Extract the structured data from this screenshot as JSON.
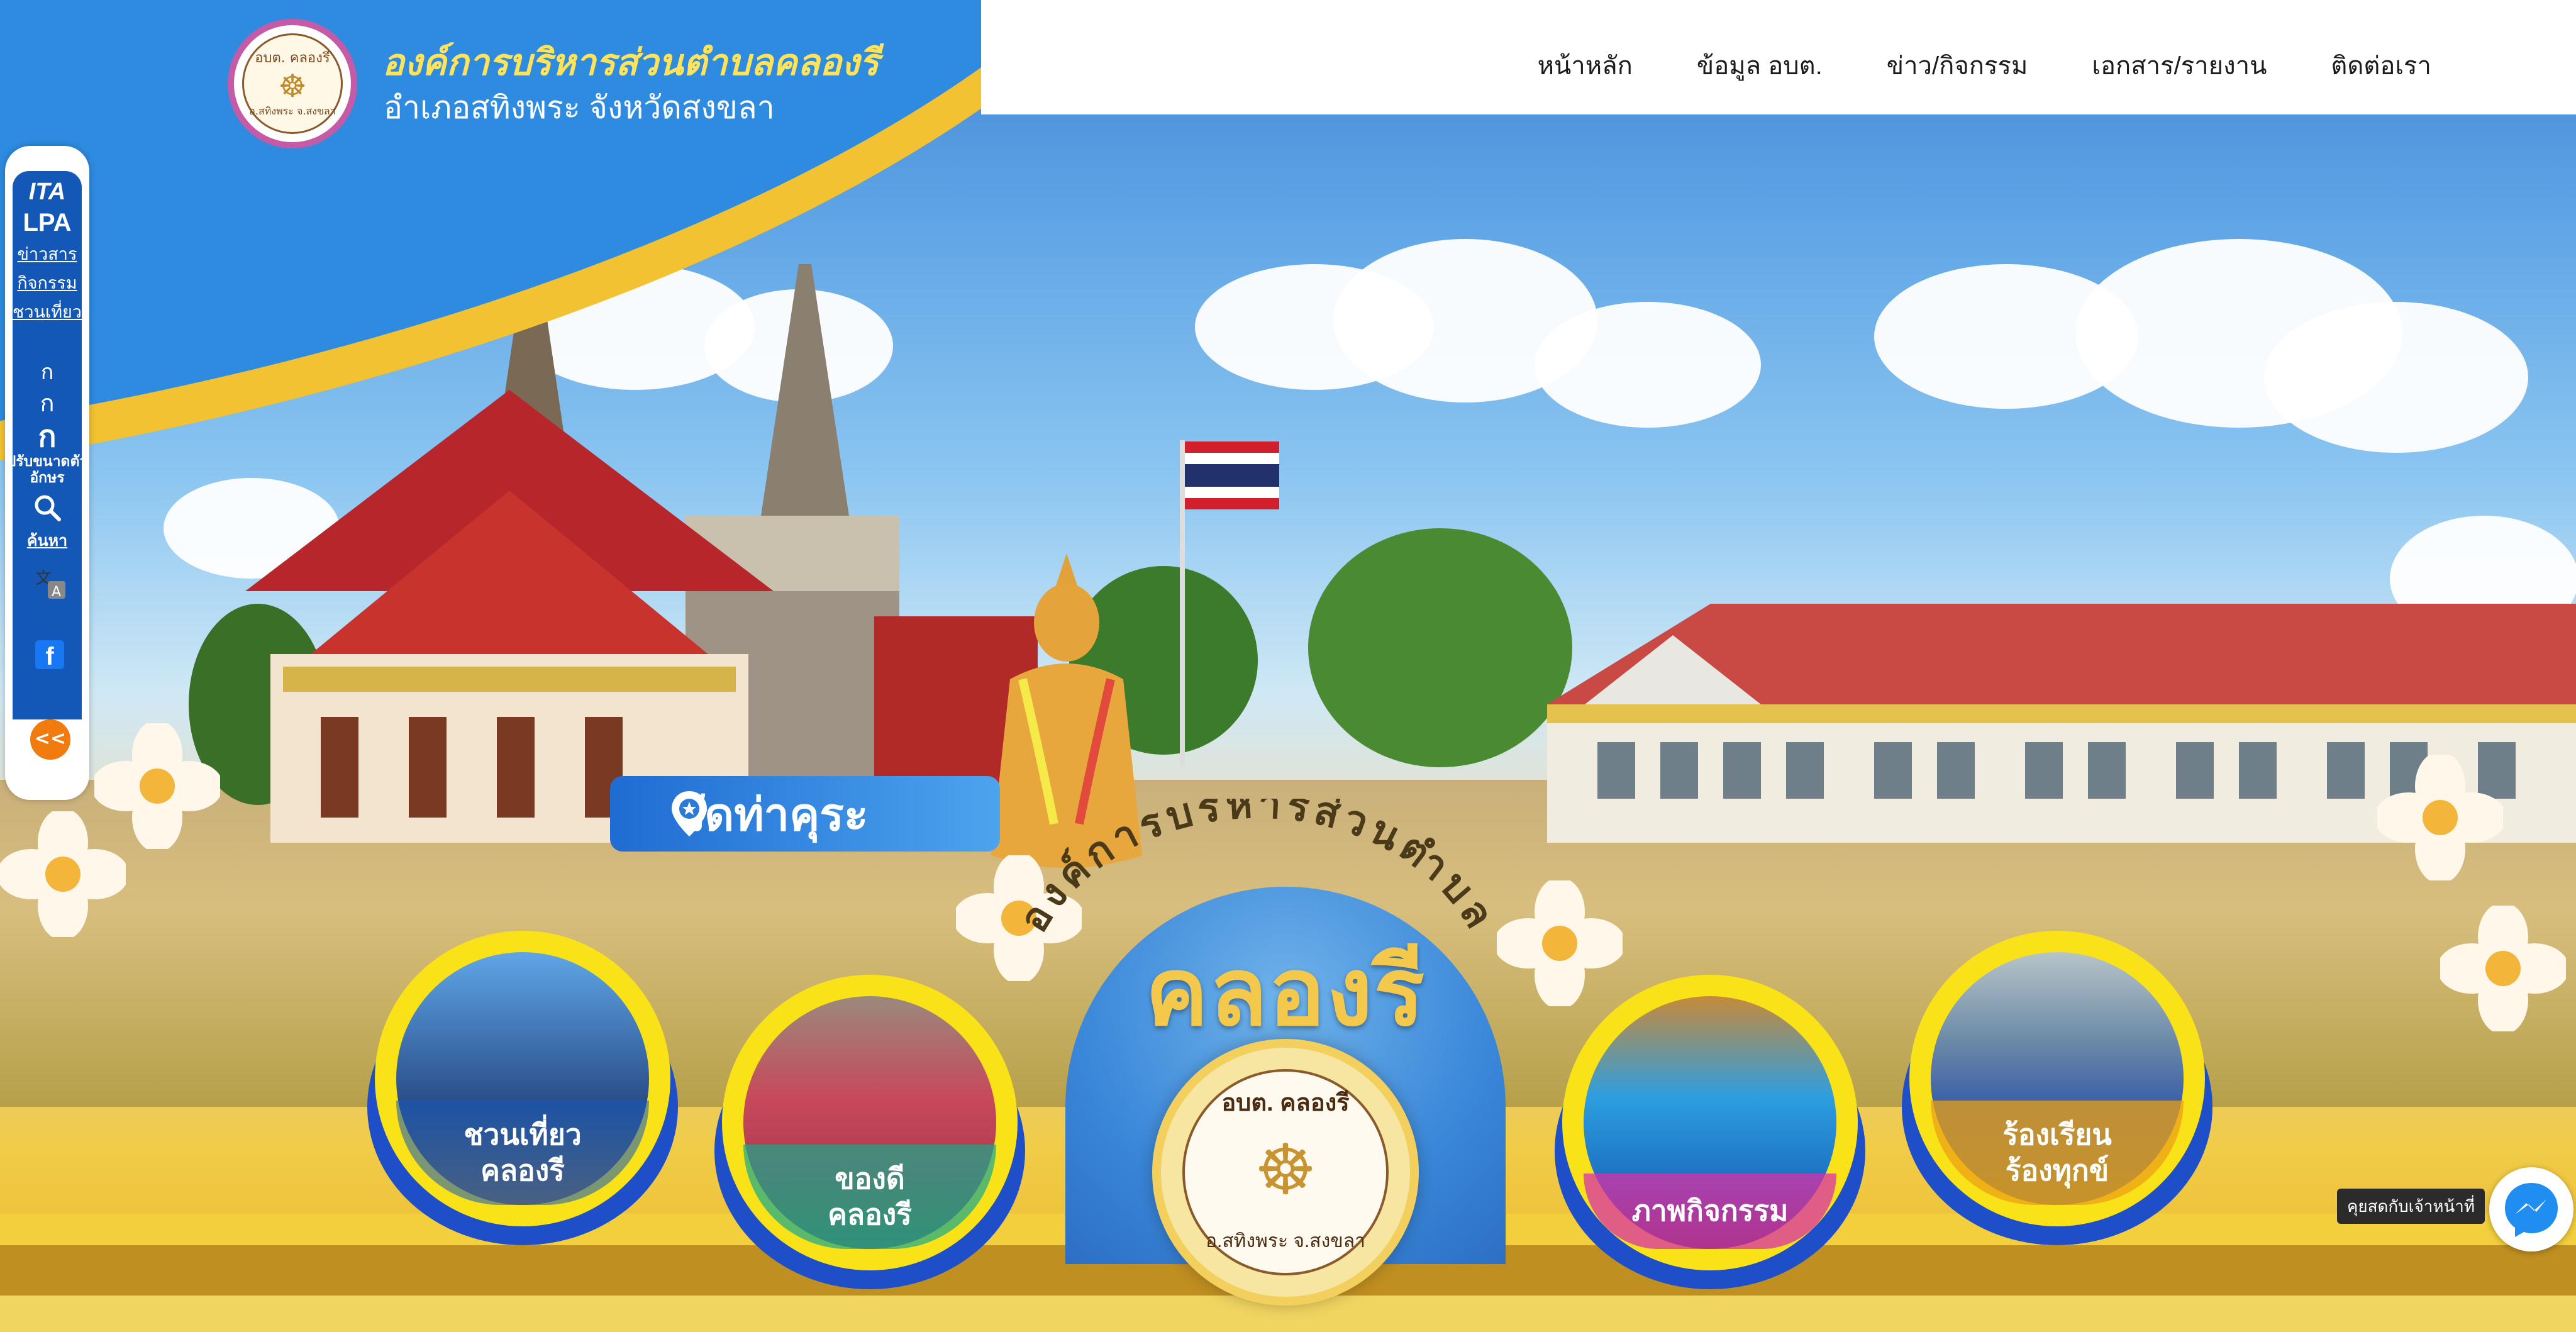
{
  "header": {
    "org_name": "องค์การบริหารส่วนตำบลคลองรี",
    "district": "อำเภอสทิงพระ จังหวัดสงขลา",
    "logo_text_top": "อบต. คลองรี",
    "logo_text_bottom": "อ.สทิงพระ จ.สงขลา"
  },
  "nav": {
    "items": [
      {
        "label": "หน้าหลัก"
      },
      {
        "label": "ข้อมูล อบต."
      },
      {
        "label": "ข่าว/กิจกรรม"
      },
      {
        "label": "เอกสาร/รายงาน"
      },
      {
        "label": "ติดต่อเรา"
      }
    ]
  },
  "sidebar": {
    "itax": "ITA",
    "lpa": "LPA",
    "links": [
      "ข่าวสาร",
      "กิจกรรม",
      "ชวนเที่ยว"
    ],
    "font_small": "ก",
    "font_medium": "ก",
    "font_large": "ก",
    "font_label": "ปรับขนาดตัวอักษร",
    "search_label": "ค้นหา",
    "facebook": "f",
    "collapse": "<<"
  },
  "hero": {
    "place_label": "วัดท่าคุระ",
    "arc_text": "องค์การบริหารส่วนตำบล",
    "big_name": "คลองรี",
    "seal_top": "อบต. คลองรี",
    "seal_bottom": "อ.สทิงพระ จ.สงขลา"
  },
  "quick_links": [
    {
      "label_line1": "ชวนเที่ยว",
      "label_line2": "คลองรี"
    },
    {
      "label_line1": "ของดี",
      "label_line2": "คลองรี"
    },
    {
      "label_line1": "ภาพกิจกรรม",
      "label_line2": ""
    },
    {
      "label_line1": "ร้องเรียน",
      "label_line2": "ร้องทุกข์"
    }
  ],
  "chat": {
    "label": "คุยสดกับเจ้าหน้าที่"
  },
  "colors": {
    "nav_bg": "#ffffff",
    "sidebar_blue": "#1358b6",
    "title_yellow": "#ffe45a",
    "accent_orange": "#f07b0f",
    "circle_yellow": "#f9e218",
    "circle_blue": "#1e4fc9"
  }
}
